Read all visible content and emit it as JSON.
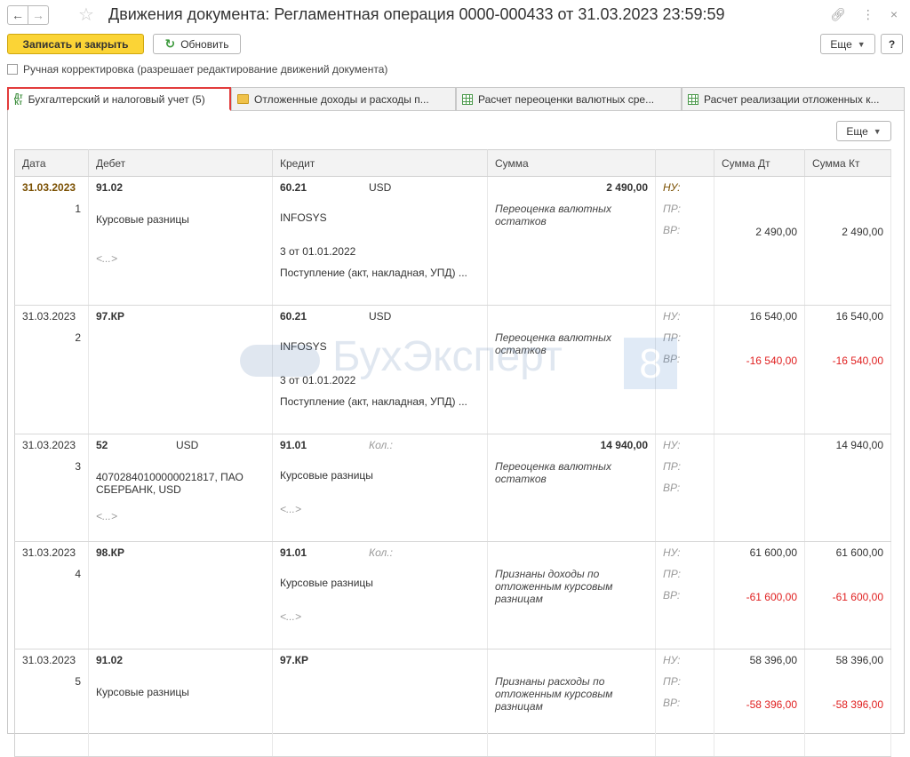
{
  "window": {
    "title": "Движения документа: Регламентная операция 0000-000433 от 31.03.2023 23:59:59"
  },
  "toolbar": {
    "save_close_label": "Записать и закрыть",
    "refresh_label": "Обновить",
    "more_label": "Еще",
    "help_label": "?"
  },
  "manual_correction_label": "Ручная корректировка (разрешает редактирование движений документа)",
  "tabs": [
    {
      "label": "Бухгалтерский и налоговый учет (5)",
      "icon": "dt-kt-icon",
      "active": true
    },
    {
      "label": "Отложенные доходы и расходы п...",
      "icon": "folder-icon",
      "active": false
    },
    {
      "label": "Расчет переоценки валютных сре...",
      "icon": "grid-icon",
      "active": false
    },
    {
      "label": "Расчет реализации отложенных к...",
      "icon": "grid-icon",
      "active": false
    }
  ],
  "table_more_label": "Еще",
  "columns": [
    "Дата",
    "Дебет",
    "Кредит",
    "Сумма",
    "",
    "Сумма Дт",
    "Сумма Кт"
  ],
  "labels": {
    "nu": "НУ:",
    "pr": "ПР:",
    "vr": "ВР:",
    "kol": "Кол.:",
    "dots": "<...>"
  },
  "watermark": {
    "text": "БухЭксперт",
    "digit": "8"
  },
  "rows": [
    {
      "date": "31.03.2023",
      "num": "1",
      "debit": "91.02",
      "debit_cur": "",
      "debit_sub": [
        "Курсовые разницы",
        "<...>"
      ],
      "credit": "60.21",
      "credit_cur": "USD",
      "credit_kol": false,
      "credit_sub": [
        "INFOSYS",
        "3 от 01.01.2022",
        "Поступление (акт, накладная, УПД) ..."
      ],
      "sum": "2 490,00",
      "desc": "Переоценка валютных остатков",
      "nu_dt": "",
      "nu_kt": "",
      "vr_dt": "2 490,00",
      "vr_kt": "2 490,00",
      "highlight": true,
      "neg": false
    },
    {
      "date": "31.03.2023",
      "num": "2",
      "debit": "97.КР",
      "debit_cur": "",
      "debit_sub": [
        "",
        ""
      ],
      "credit": "60.21",
      "credit_cur": "USD",
      "credit_kol": false,
      "credit_sub": [
        "INFOSYS",
        "3 от 01.01.2022",
        "Поступление (акт, накладная, УПД) ..."
      ],
      "sum": "",
      "desc": "Переоценка валютных остатков",
      "nu_dt": "16 540,00",
      "nu_kt": "16 540,00",
      "vr_dt": "-16 540,00",
      "vr_kt": "-16 540,00",
      "highlight": false,
      "neg": true
    },
    {
      "date": "31.03.2023",
      "num": "3",
      "debit": "52",
      "debit_cur": "USD",
      "debit_sub": [
        "40702840100000021817, ПАО СБЕРБАНК, USD",
        "<...>"
      ],
      "credit": "91.01",
      "credit_cur": "",
      "credit_kol": true,
      "credit_sub": [
        "Курсовые разницы",
        "<...>",
        ""
      ],
      "sum": "14 940,00",
      "desc": "Переоценка валютных остатков",
      "nu_dt": "",
      "nu_kt": "14 940,00",
      "vr_dt": "",
      "vr_kt": "",
      "highlight": false,
      "neg": false
    },
    {
      "date": "31.03.2023",
      "num": "4",
      "debit": "98.КР",
      "debit_cur": "",
      "debit_sub": [
        "",
        ""
      ],
      "credit": "91.01",
      "credit_cur": "",
      "credit_kol": true,
      "credit_sub": [
        "Курсовые разницы",
        "<...>",
        ""
      ],
      "sum": "",
      "desc": "Признаны доходы по отложенным курсовым разницам",
      "nu_dt": "61 600,00",
      "nu_kt": "61 600,00",
      "vr_dt": "-61 600,00",
      "vr_kt": "-61 600,00",
      "highlight": false,
      "neg": true
    },
    {
      "date": "31.03.2023",
      "num": "5",
      "debit": "91.02",
      "debit_cur": "",
      "debit_sub": [
        "Курсовые разницы",
        ""
      ],
      "credit": "97.КР",
      "credit_cur": "",
      "credit_kol": false,
      "credit_sub": [
        "",
        "",
        ""
      ],
      "sum": "",
      "desc": "Признаны расходы по отложенным курсовым разницам",
      "nu_dt": "58 396,00",
      "nu_kt": "58 396,00",
      "vr_dt": "-58 396,00",
      "vr_kt": "-58 396,00",
      "highlight": false,
      "neg": true
    }
  ]
}
